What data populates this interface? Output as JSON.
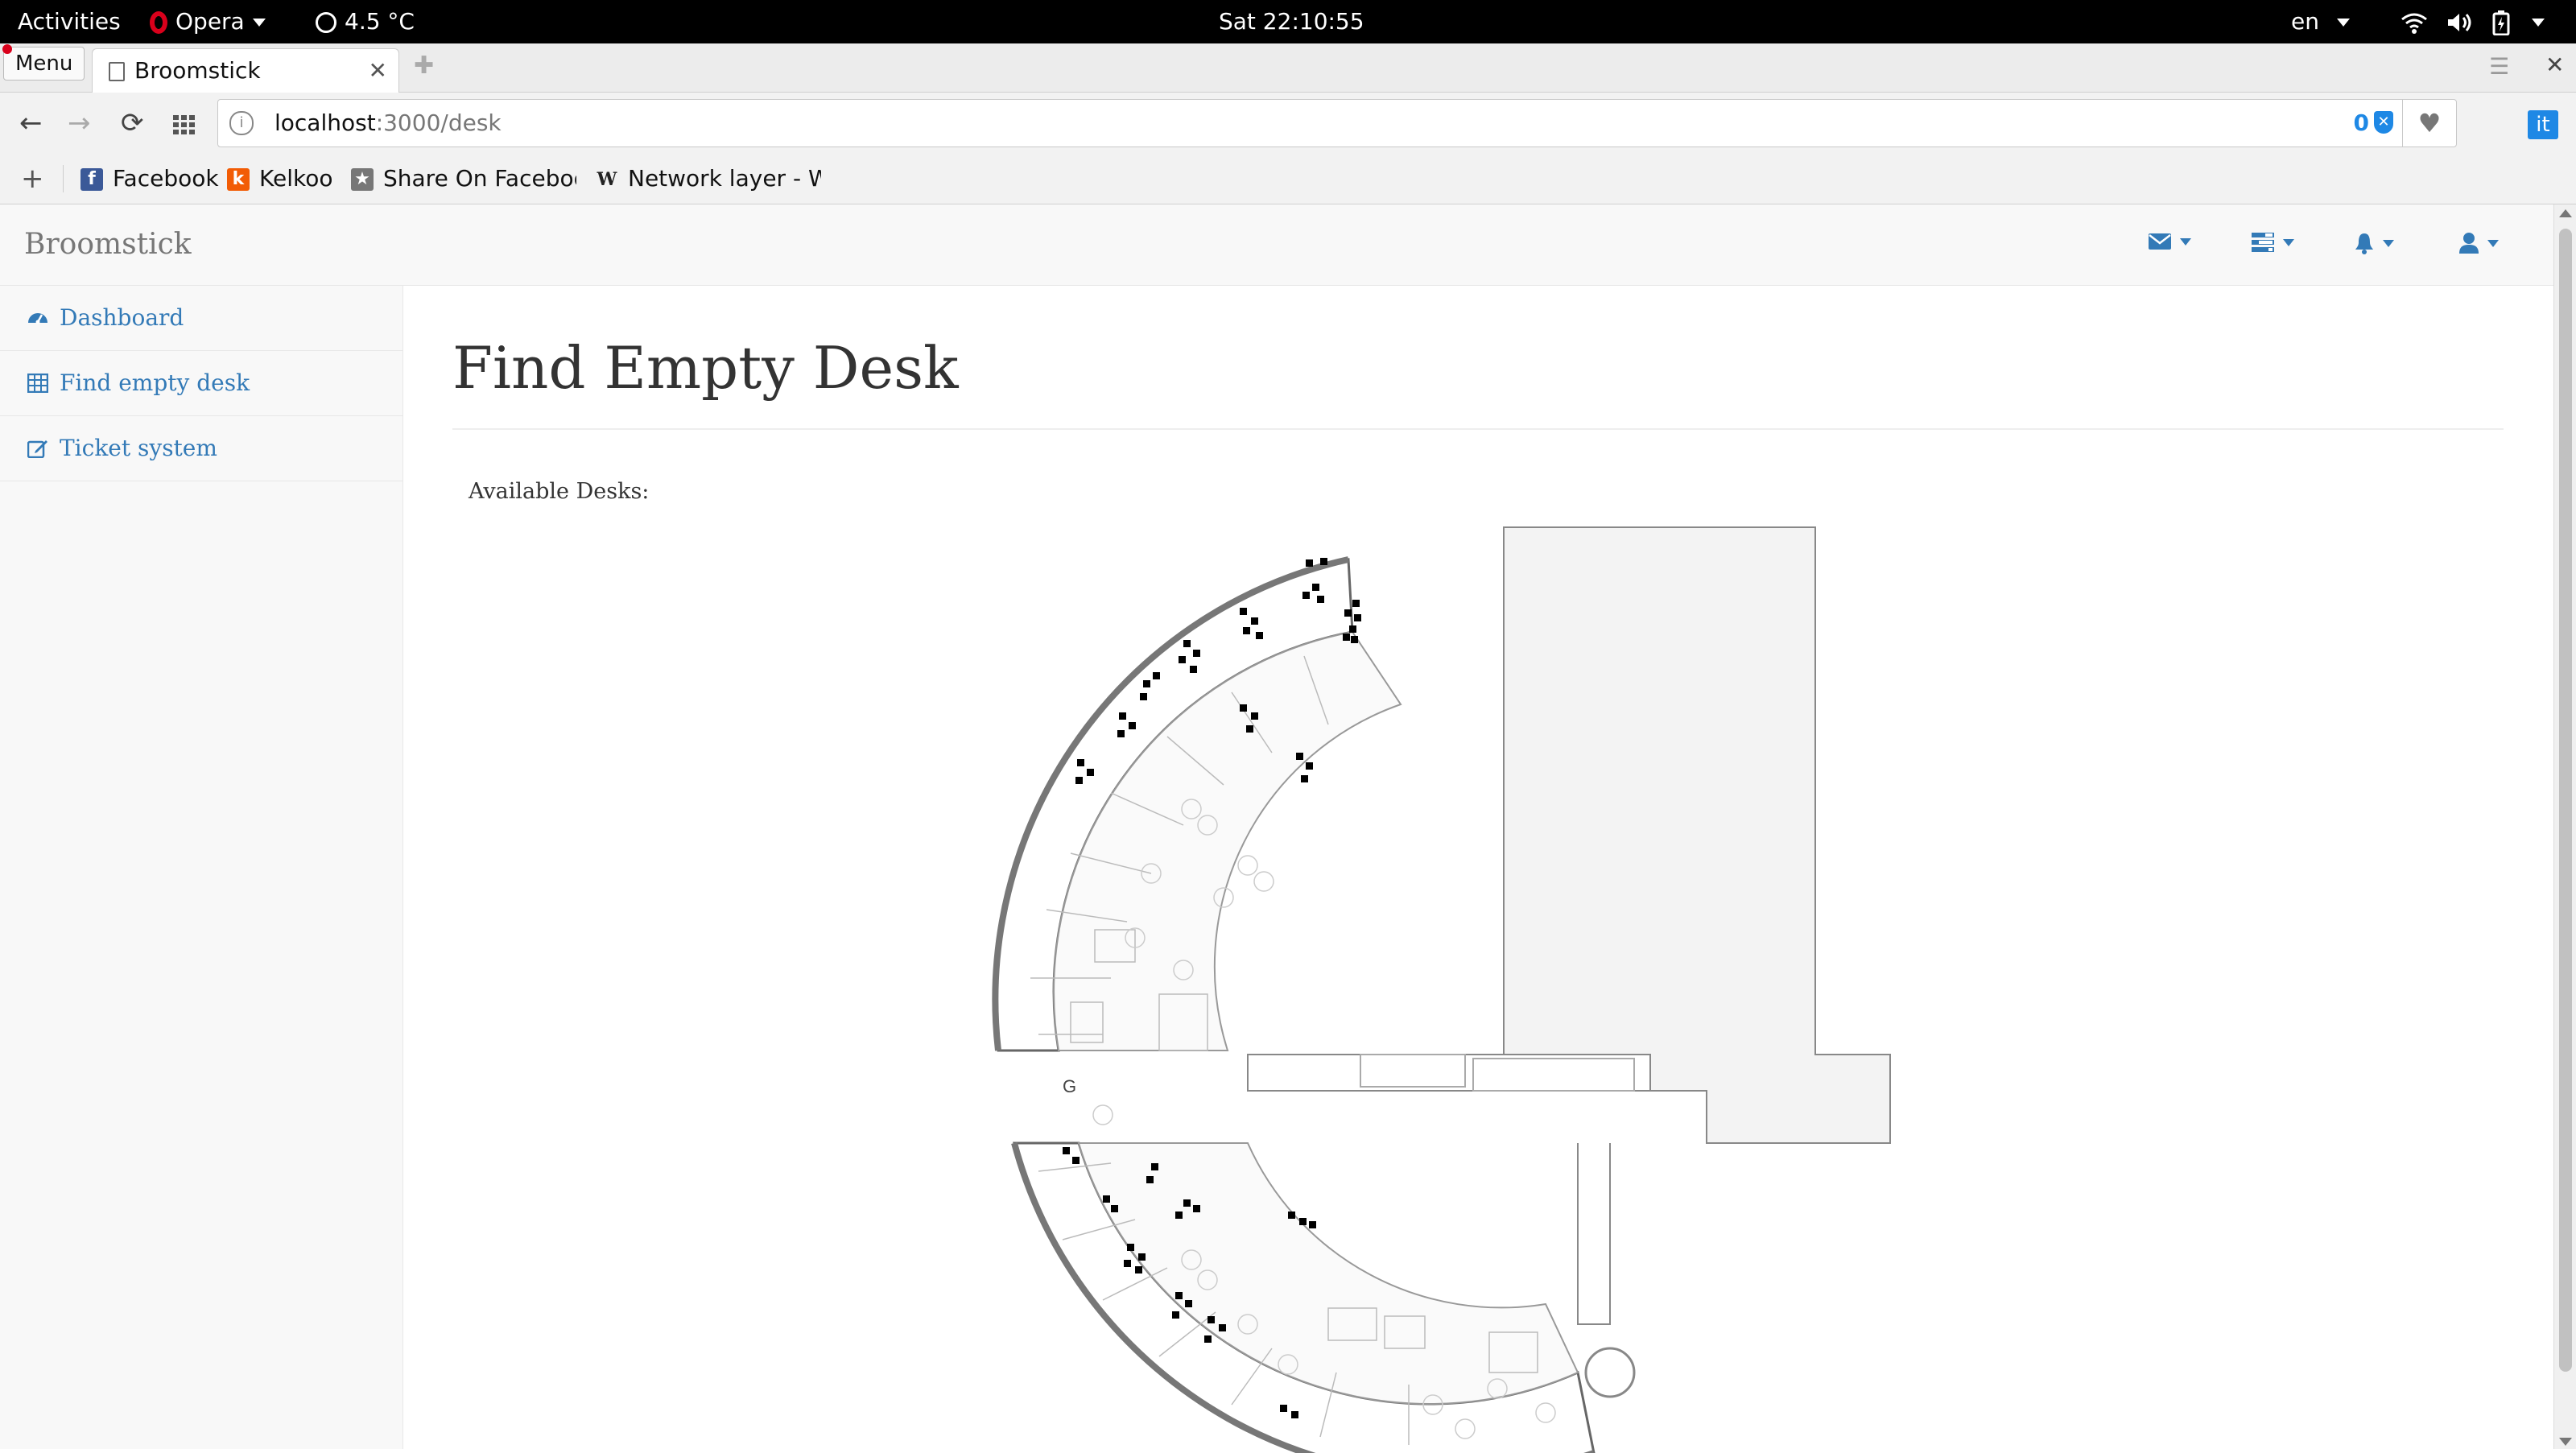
{
  "os_bar": {
    "activities": "Activities",
    "app_name": "Opera",
    "weather": "4.5 °C",
    "clock": "Sat 22:10:55",
    "language": "en"
  },
  "browser": {
    "menu_label": "Menu",
    "tab_title": "Broomstick",
    "url_host": "localhost",
    "url_path": ":3000/desk",
    "adblock_count": "0",
    "extension_label": "it",
    "bookmarks": [
      {
        "label": "Facebook",
        "icon": "facebook-icon"
      },
      {
        "label": "Kelkoo",
        "icon": "kelkoo-icon"
      },
      {
        "label": "Share On Faceboo",
        "icon": "share-icon"
      },
      {
        "label": "Network layer - W",
        "icon": "wikipedia-icon"
      }
    ]
  },
  "app": {
    "brand": "Broomstick",
    "header_icons": [
      "envelope-icon",
      "tasks-icon",
      "bell-icon",
      "user-icon"
    ],
    "sidebar": [
      {
        "label": "Dashboard",
        "icon": "dashboard-icon"
      },
      {
        "label": "Find empty desk",
        "icon": "table-icon"
      },
      {
        "label": "Ticket system",
        "icon": "edit-icon"
      }
    ],
    "page_title": "Find Empty Desk",
    "available_label": "Available Desks:"
  },
  "colors": {
    "link": "#337ab7",
    "top_bar": "#000000",
    "opera_red": "#d9001b"
  }
}
